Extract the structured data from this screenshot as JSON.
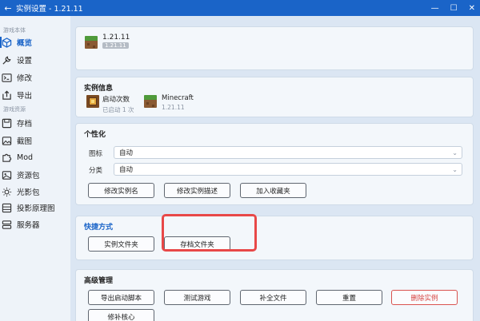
{
  "titlebar": {
    "back": "←",
    "title": "实例设置 - 1.21.11",
    "minimize": "—",
    "maximize": "☐",
    "close": "✕"
  },
  "sidebar": {
    "section1": "游戏本体",
    "section2": "游戏资源",
    "items": [
      {
        "label": "概览",
        "icon": "cube-icon",
        "active": true
      },
      {
        "label": "设置",
        "icon": "wrench-icon"
      },
      {
        "label": "修改",
        "icon": "terminal-icon"
      },
      {
        "label": "导出",
        "icon": "export-icon"
      },
      {
        "label": "存档",
        "icon": "save-icon"
      },
      {
        "label": "截图",
        "icon": "image-icon"
      },
      {
        "label": "Mod",
        "icon": "puzzle-icon"
      },
      {
        "label": "资源包",
        "icon": "picture-icon"
      },
      {
        "label": "光影包",
        "icon": "sun-icon"
      },
      {
        "label": "投影原理图",
        "icon": "layers-icon"
      },
      {
        "label": "服务器",
        "icon": "server-icon"
      }
    ]
  },
  "header_card": {
    "name": "1.21.11",
    "badge": "1.21.11"
  },
  "info": {
    "title": "实例信息",
    "launch_label": "启动次数",
    "launch_value": "已启动 1 次",
    "game_label": "Minecraft",
    "game_version": "1.21.11"
  },
  "personalize": {
    "title": "个性化",
    "icon_label": "图标",
    "icon_value": "自动",
    "category_label": "分类",
    "category_value": "自动",
    "buttons": {
      "rename": "修改实例名",
      "describe": "修改实例描述",
      "favorite": "加入收藏夹"
    }
  },
  "shortcuts": {
    "title": "快捷方式",
    "instance_folder": "实例文件夹",
    "saves_folder": "存档文件夹"
  },
  "advanced": {
    "title": "高级管理",
    "export_script": "导出启动脚本",
    "test_game": "测试游戏",
    "complete_files": "补全文件",
    "reset": "重置",
    "delete": "删除实例",
    "repair_core": "修补核心"
  },
  "colors": {
    "accent": "#1a64c8",
    "danger": "#d64541",
    "highlight": "#e84848"
  }
}
